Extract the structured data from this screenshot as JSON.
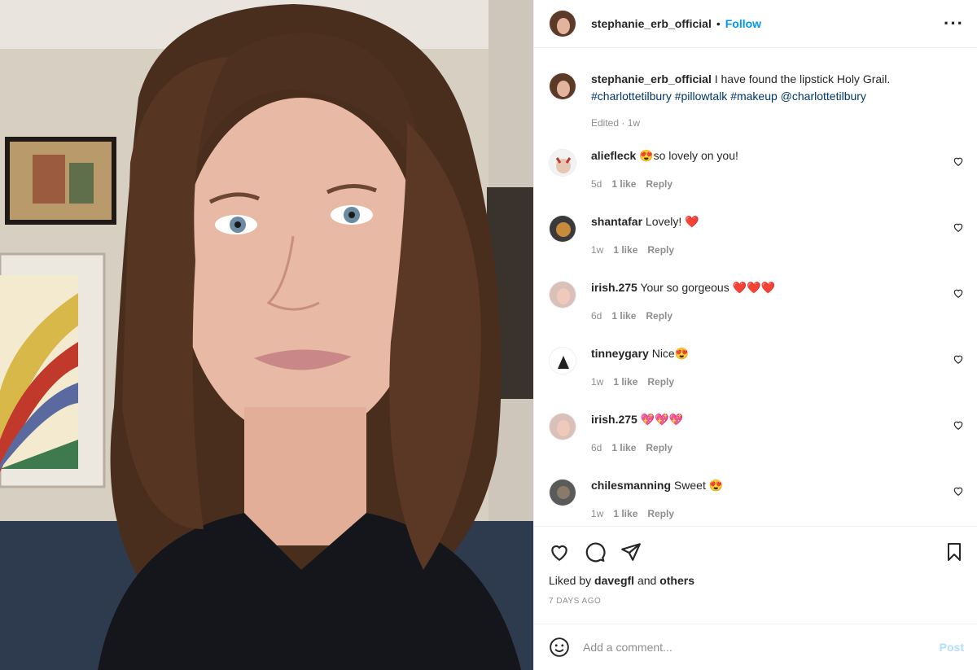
{
  "post": {
    "username": "stephanie_erb_official",
    "follow_label": "Follow",
    "dot": "•",
    "more_icon": "more-options-icon"
  },
  "caption": {
    "username": "stephanie_erb_official",
    "text": "I have found the lipstick Holy Grail.",
    "tags": "#charlottetilbury #pillowtalk #makeup @charlottetilbury",
    "meta": "Edited · 1w"
  },
  "comments": [
    {
      "username": "aliefleck",
      "text": "😍so lovely on you!",
      "age": "5d",
      "likes": "1 like",
      "reply": "Reply"
    },
    {
      "username": "shantafar",
      "text": "Lovely! ❤️",
      "age": "1w",
      "likes": "1 like",
      "reply": "Reply"
    },
    {
      "username": "irish.275",
      "text": "Your so gorgeous ❤️❤️❤️",
      "age": "6d",
      "likes": "1 like",
      "reply": "Reply"
    },
    {
      "username": "tinneygary",
      "text": "Nice😍",
      "age": "1w",
      "likes": "1 like",
      "reply": "Reply"
    },
    {
      "username": "irish.275",
      "text": "💖💖💖",
      "age": "6d",
      "likes": "1 like",
      "reply": "Reply"
    },
    {
      "username": "chilesmanning",
      "text": "Sweet 😍",
      "age": "1w",
      "likes": "1 like",
      "reply": "Reply"
    }
  ],
  "footer": {
    "liked_prefix": "Liked by",
    "liked_user": "davegfl",
    "liked_and": "and",
    "liked_others": "others",
    "time_ago": "7 DAYS AGO",
    "comment_placeholder": "Add a comment...",
    "post_label": "Post"
  },
  "colors": {
    "accent": "#0095f6",
    "post_disabled": "#b2dffc",
    "link": "#00376b",
    "muted": "#8e8e8e"
  }
}
